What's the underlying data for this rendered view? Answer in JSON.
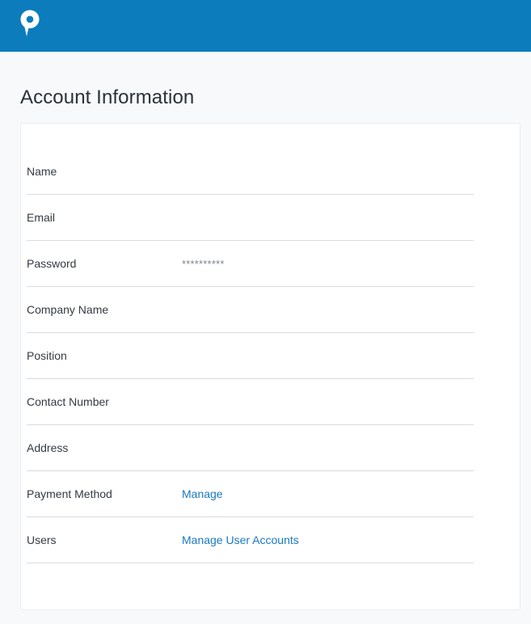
{
  "header": {
    "logo_icon": "map-pin-p-logo-icon",
    "background_color": "#0c7cbd"
  },
  "page": {
    "title": "Account Information"
  },
  "account": {
    "rows": [
      {
        "label": "Name",
        "value": "",
        "type": "text"
      },
      {
        "label": "Email",
        "value": "",
        "type": "text"
      },
      {
        "label": "Password",
        "value": "**********",
        "type": "masked"
      },
      {
        "label": "Company Name",
        "value": "",
        "type": "text"
      },
      {
        "label": "Position",
        "value": "",
        "type": "text"
      },
      {
        "label": "Contact Number",
        "value": "",
        "type": "text"
      },
      {
        "label": "Address",
        "value": "",
        "type": "text"
      },
      {
        "label": "Payment Method",
        "value": "Manage",
        "type": "link"
      },
      {
        "label": "Users",
        "value": "Manage User Accounts",
        "type": "link"
      }
    ]
  },
  "colors": {
    "link": "#1a78c2",
    "divider": "#d8dce0"
  }
}
